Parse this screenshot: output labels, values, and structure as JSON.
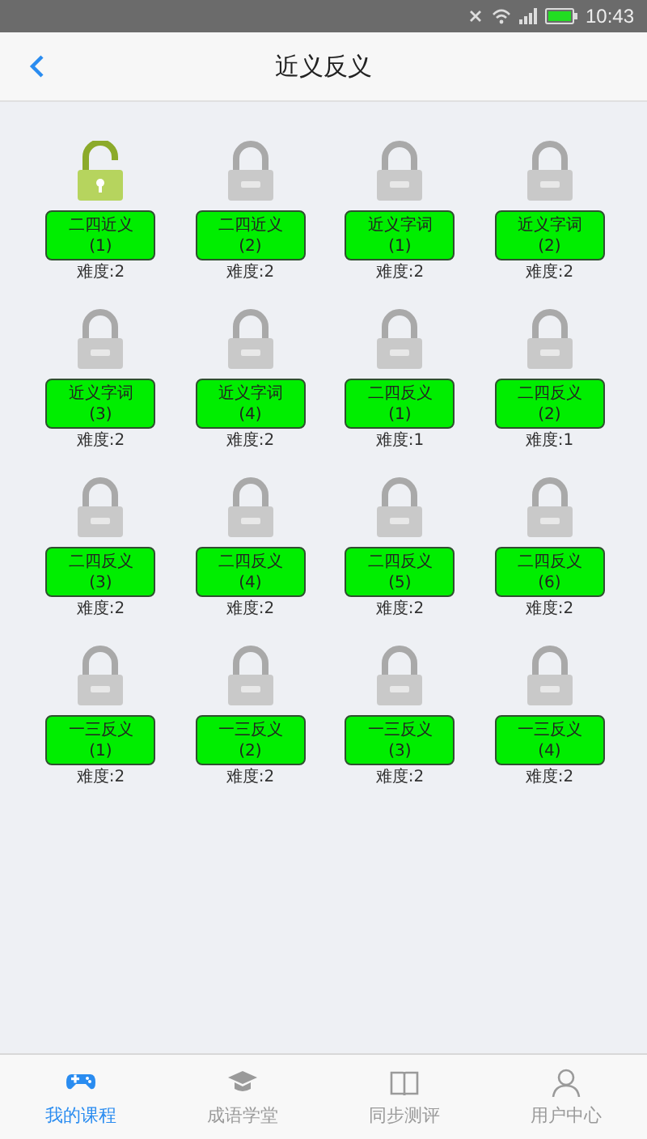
{
  "status_bar": {
    "time": "10:43"
  },
  "header": {
    "title": "近义反义"
  },
  "lessons": [
    {
      "name": "二四近义",
      "number": "(1)",
      "difficulty": "难度:2",
      "unlocked": true
    },
    {
      "name": "二四近义",
      "number": "(2)",
      "difficulty": "难度:2",
      "unlocked": false
    },
    {
      "name": "近义字词",
      "number": "(1)",
      "difficulty": "难度:2",
      "unlocked": false
    },
    {
      "name": "近义字词",
      "number": "(2)",
      "difficulty": "难度:2",
      "unlocked": false
    },
    {
      "name": "近义字词",
      "number": "(3)",
      "difficulty": "难度:2",
      "unlocked": false
    },
    {
      "name": "近义字词",
      "number": "(4)",
      "difficulty": "难度:2",
      "unlocked": false
    },
    {
      "name": "二四反义",
      "number": "(1)",
      "difficulty": "难度:1",
      "unlocked": false
    },
    {
      "name": "二四反义",
      "number": "(2)",
      "difficulty": "难度:1",
      "unlocked": false
    },
    {
      "name": "二四反义",
      "number": "(3)",
      "difficulty": "难度:2",
      "unlocked": false
    },
    {
      "name": "二四反义",
      "number": "(4)",
      "difficulty": "难度:2",
      "unlocked": false
    },
    {
      "name": "二四反义",
      "number": "(5)",
      "difficulty": "难度:2",
      "unlocked": false
    },
    {
      "name": "二四反义",
      "number": "(6)",
      "difficulty": "难度:2",
      "unlocked": false
    },
    {
      "name": "一三反义",
      "number": "(1)",
      "difficulty": "难度:2",
      "unlocked": false
    },
    {
      "name": "一三反义",
      "number": "(2)",
      "difficulty": "难度:2",
      "unlocked": false
    },
    {
      "name": "一三反义",
      "number": "(3)",
      "difficulty": "难度:2",
      "unlocked": false
    },
    {
      "name": "一三反义",
      "number": "(4)",
      "difficulty": "难度:2",
      "unlocked": false
    }
  ],
  "tab_bar": [
    {
      "label": "我的课程",
      "selected": true
    },
    {
      "label": "成语学堂",
      "selected": false
    },
    {
      "label": "同步测评",
      "selected": false
    },
    {
      "label": "用户中心",
      "selected": false
    }
  ]
}
